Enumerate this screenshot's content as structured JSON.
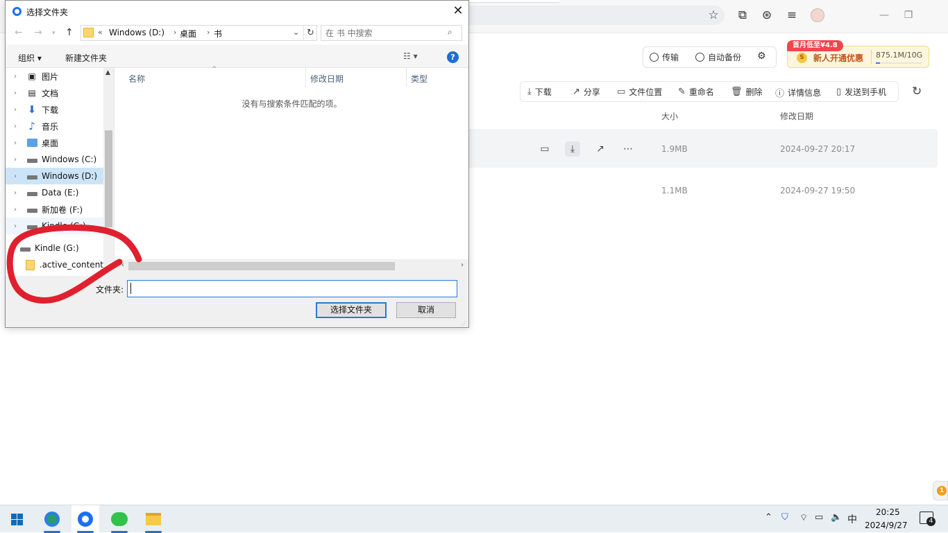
{
  "browser": {
    "icons": [
      "star-icon",
      "extensions-icon",
      "download-icon",
      "menu-icon",
      "avatar",
      "minimize-icon",
      "restore-icon"
    ]
  },
  "cloud": {
    "transfer_label": "传输",
    "backup_label": "自动备份",
    "promo_badge": "首月低至¥4.8",
    "promo_text": "新人开通优惠",
    "promo_coin": "S",
    "quota_text": "875.1M/10G",
    "quota_fraction": 0.085,
    "actions": [
      "下载",
      "分享",
      "文件位置",
      "重命名",
      "删除",
      "详情信息",
      "发送到手机"
    ],
    "columns": {
      "size": "大小",
      "modified": "修改日期"
    },
    "rows": [
      {
        "size": "1.9MB",
        "modified": "2024-09-27 20:17"
      },
      {
        "size": "1.1MB",
        "modified": "2024-09-27 19:50"
      }
    ],
    "side_badge_count": "1"
  },
  "dialog": {
    "title": "选择文件夹",
    "breadcrumb": [
      "Windows (D:)",
      "桌面",
      "书"
    ],
    "breadcrumb_prefix": "«",
    "search_placeholder": "在 书 中搜索",
    "organize_label": "组织 ▾",
    "new_folder_label": "新建文件夹",
    "help_label": "?",
    "tree": [
      {
        "label": "图片",
        "icon": "pictures-icon"
      },
      {
        "label": "文档",
        "icon": "documents-icon"
      },
      {
        "label": "下载",
        "icon": "downloads-icon"
      },
      {
        "label": "音乐",
        "icon": "music-icon"
      },
      {
        "label": "桌面",
        "icon": "desktop-icon"
      },
      {
        "label": "Windows (C:)",
        "icon": "drive-icon"
      },
      {
        "label": "Windows (D:)",
        "icon": "drive-icon",
        "selected": true
      },
      {
        "label": "Data (E:)",
        "icon": "drive-icon"
      },
      {
        "label": "新加卷 (F:)",
        "icon": "drive-icon"
      },
      {
        "label": "Kindle (G:)",
        "icon": "drive-icon"
      },
      {
        "label": "Kindle (G:)",
        "icon": "drive-icon"
      },
      {
        "label": ".active_content",
        "icon": "folder-icon"
      }
    ],
    "columns": {
      "name": "名称",
      "modified": "修改日期",
      "type": "类型"
    },
    "empty_message": "没有与搜索条件匹配的项。",
    "folder_label": "文件夹:",
    "folder_value": "",
    "select_button": "选择文件夹",
    "cancel_button": "取消"
  },
  "annotation_color": "#e0202e",
  "taskbar": {
    "time": "20:25",
    "date": "2024/9/27",
    "ime": "中",
    "notification_count": "4"
  }
}
